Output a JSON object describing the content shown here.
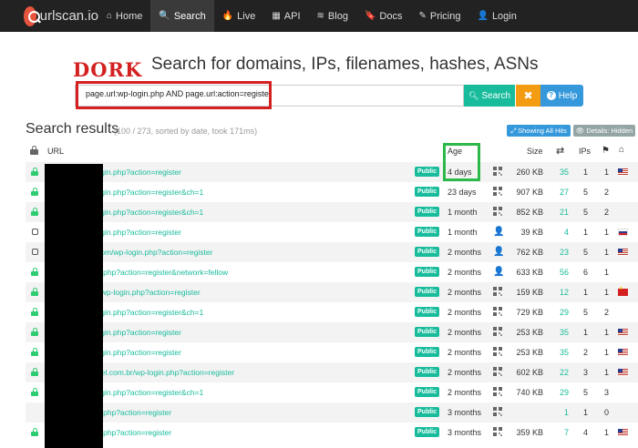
{
  "navbar": {
    "brand": "urlscan.io",
    "items": [
      {
        "label": "Home",
        "icon": "home-icon",
        "glyph": "⌂"
      },
      {
        "label": "Search",
        "icon": "search-icon",
        "glyph": "🔍"
      },
      {
        "label": "Live",
        "icon": "fire-icon",
        "glyph": "🔥"
      },
      {
        "label": "API",
        "icon": "qrcode-icon",
        "glyph": "▦"
      },
      {
        "label": "Blog",
        "icon": "rss-icon",
        "glyph": "≋"
      },
      {
        "label": "Docs",
        "icon": "bookmark-icon",
        "glyph": "🔖"
      },
      {
        "label": "Pricing",
        "icon": "edit-icon",
        "glyph": "✎"
      },
      {
        "label": "Login",
        "icon": "user-icon",
        "glyph": "👤"
      }
    ],
    "active": "Search"
  },
  "annotation": {
    "dork_label": "DORK"
  },
  "search": {
    "heading": "Search for domains, IPs, filenames, hashes, ASNs",
    "query": "page.url:wp-login.php AND page.url:action=register",
    "search_label": "Search",
    "clear_label": "✖",
    "help_label": "Help"
  },
  "results": {
    "title": "Search results",
    "meta": "(100 / 273, sorted by date, took 171ms)",
    "show_all_hits": "Showing All Hits",
    "details_hidden": "Details: Hidden"
  },
  "table": {
    "headers": {
      "url": "URL",
      "age": "Age",
      "size": "Size",
      "ips": "IPs"
    },
    "rows": [
      {
        "status": "lock",
        "url": "wp-login.php?action=register",
        "visibility": "Public",
        "age": "4 days",
        "thumb": "qr",
        "size": "260 KB",
        "links": "35",
        "ips": "1",
        "countries": "1",
        "flag": "us"
      },
      {
        "status": "lock",
        "url": "wp-login.php?action=register&ch=1",
        "visibility": "Public",
        "age": "23 days",
        "thumb": "qr",
        "size": "907 KB",
        "links": "27",
        "ips": "5",
        "countries": "2",
        "flag": ""
      },
      {
        "status": "lock",
        "url": "wp-login.php?action=register&ch=1",
        "visibility": "Public",
        "age": "1 month",
        "thumb": "qr",
        "size": "852 KB",
        "links": "21",
        "ips": "5",
        "countries": "2",
        "flag": ""
      },
      {
        "status": "checkbox",
        "url": "wp-login.php?action=register",
        "visibility": "Public",
        "age": "1 month",
        "thumb": "user",
        "size": "39 KB",
        "links": "4",
        "ips": "1",
        "countries": "1",
        "flag": "ru"
      },
      {
        "status": "checkbox",
        "url": "ece.com/wp-login.php?action=register",
        "visibility": "Public",
        "age": "2 months",
        "thumb": "user",
        "size": "762 KB",
        "links": "23",
        "ips": "5",
        "countries": "1",
        "flag": "us"
      },
      {
        "status": "lock",
        "url": "-login.php?action=register&network=fellow",
        "visibility": "Public",
        "age": "2 months",
        "thumb": "user",
        "size": "633 KB",
        "links": "56",
        "ips": "6",
        "countries": "1",
        "flag": ""
      },
      {
        "status": "lock",
        "url": ".com/wp-login.php?action=register",
        "visibility": "Public",
        "age": "2 months",
        "thumb": "qr",
        "size": "159 KB",
        "links": "12",
        "ips": "1",
        "countries": "1",
        "flag": "cn"
      },
      {
        "status": "lock",
        "url": "wp-login.php?action=register&ch=1",
        "visibility": "Public",
        "age": "2 months",
        "thumb": "qr",
        "size": "729 KB",
        "links": "29",
        "ips": "5",
        "countries": "2",
        "flag": ""
      },
      {
        "status": "lock",
        "url": "wp-login.php?action=register",
        "visibility": "Public",
        "age": "2 months",
        "thumb": "qr",
        "size": "253 KB",
        "links": "35",
        "ips": "1",
        "countries": "1",
        "flag": "us"
      },
      {
        "status": "lock",
        "url": "wp-login.php?action=register",
        "visibility": "Public",
        "age": "2 months",
        "thumb": "qr",
        "size": "253 KB",
        "links": "35",
        "ips": "2",
        "countries": "1",
        "flag": "us"
      },
      {
        "status": "lock",
        "url": "cehotel.com.br/wp-login.php?action=register",
        "visibility": "Public",
        "age": "2 months",
        "thumb": "qr",
        "size": "602 KB",
        "links": "22",
        "ips": "3",
        "countries": "1",
        "flag": "us"
      },
      {
        "status": "lock",
        "url": "wp-login.php?action=register&ch=1",
        "visibility": "Public",
        "age": "2 months",
        "thumb": "qr",
        "size": "740 KB",
        "links": "29",
        "ips": "5",
        "countries": "3",
        "flag": ""
      },
      {
        "status": "none",
        "url": "-login.php?action=register",
        "visibility": "Public",
        "age": "3 months",
        "thumb": "qr",
        "size": "",
        "links": "1",
        "ips": "1",
        "countries": "0",
        "flag": ""
      },
      {
        "status": "lock",
        "url": "-login.php?action=register",
        "visibility": "Public",
        "age": "3 months",
        "thumb": "qr",
        "size": "359 KB",
        "links": "7",
        "ips": "4",
        "countries": "1",
        "flag": "us"
      }
    ]
  }
}
